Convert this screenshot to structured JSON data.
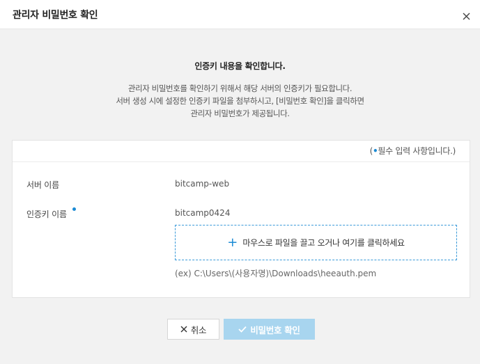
{
  "dialog": {
    "title": "관리자 비밀번호 확인",
    "close_icon": "close-icon"
  },
  "notice": {
    "title": "인증키 내용을 확인합니다.",
    "lines": [
      "관리자 비밀번호를 확인하기 위해서 해당 서버의 인증키가 필요합니다.",
      "서버 생성 시에 설정한 인증키 파일을 첨부하시고, [비밀번호 확인]을 클릭하면",
      "관리자 비밀번호가 제공됩니다."
    ]
  },
  "form": {
    "required_note_open": "(",
    "required_note_text": "필수 입력 사항입니다.)",
    "server_name_label": "서버 이름",
    "server_name_value": "bitcamp-web",
    "auth_key_label": "인증키 이름",
    "auth_key_value": "bitcamp0424",
    "dropzone_text": "마우스로 파일을 끌고 오거나 여기를 클릭하세요",
    "path_hint": "(ex) C:\\Users\\(사용자명)\\Downloads\\heeauth.pem"
  },
  "buttons": {
    "cancel_label": "취소",
    "confirm_label": "비밀번호 확인"
  },
  "colors": {
    "accent": "#1a8ad4",
    "confirm_disabled": "#a8d5ef"
  }
}
